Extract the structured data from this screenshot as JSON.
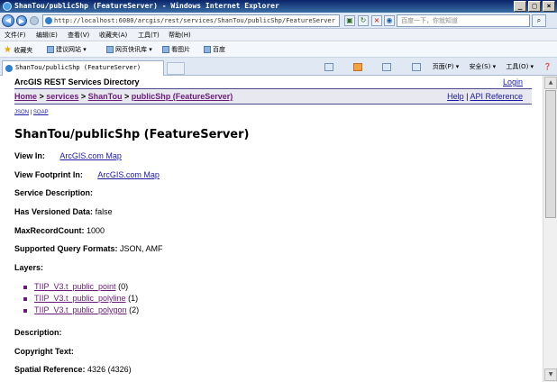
{
  "window": {
    "title": "ShanTou/publicShp (FeatureServer) - Windows Internet Explorer"
  },
  "address_bar": {
    "url": "http://localhost:6080/arcgis/rest/services/ShanTou/publicShp/FeatureServer",
    "search_placeholder": "百度一下，你就知道"
  },
  "menu": [
    "文件(F)",
    "编辑(E)",
    "查看(V)",
    "收藏夹(A)",
    "工具(T)",
    "帮助(H)"
  ],
  "favorites_bar": {
    "label": "收藏夹",
    "items": [
      "建议网站 ▾",
      "网页快讯库 ▾",
      "看图片",
      "百度"
    ]
  },
  "tab": {
    "title": "ShanTou/publicShp (FeatureServer)"
  },
  "command_bar": [
    "页面(P) ▾",
    "安全(S) ▾",
    "工具(O) ▾"
  ],
  "page": {
    "directory_title": "ArcGIS REST Services Directory",
    "login": "Login",
    "breadcrumb": {
      "home": "Home",
      "services": "services",
      "folder": "ShanTou",
      "current": "publicShp (FeatureServer)"
    },
    "help": "Help",
    "api_reference": "API Reference",
    "formats": {
      "json": "JSON",
      "soap": "SOAP"
    },
    "heading": "ShanTou/publicShp (FeatureServer)",
    "view_in_label": "View In:",
    "view_in_link": "ArcGIS.com Map",
    "view_footprint_label": "View Footprint In:",
    "view_footprint_link": "ArcGIS.com Map",
    "service_description_label": "Service Description:",
    "has_versioned_label": "Has Versioned Data:",
    "has_versioned_value": "false",
    "max_record_label": "MaxRecordCount:",
    "max_record_value": "1000",
    "query_formats_label": "Supported Query Formats:",
    "query_formats_value": "JSON, AMF",
    "layers_label": "Layers:",
    "layers": [
      {
        "name": "TIIP_V3.t_public_point",
        "id": "(0)"
      },
      {
        "name": "TIIP_V3.t_public_polyline",
        "id": "(1)"
      },
      {
        "name": "TIIP_V3.t_public_polygon",
        "id": "(2)"
      }
    ],
    "description_label": "Description:",
    "copyright_label": "Copyright Text:",
    "spatial_ref_label": "Spatial Reference:",
    "spatial_ref_value": "4326  (4326)"
  }
}
